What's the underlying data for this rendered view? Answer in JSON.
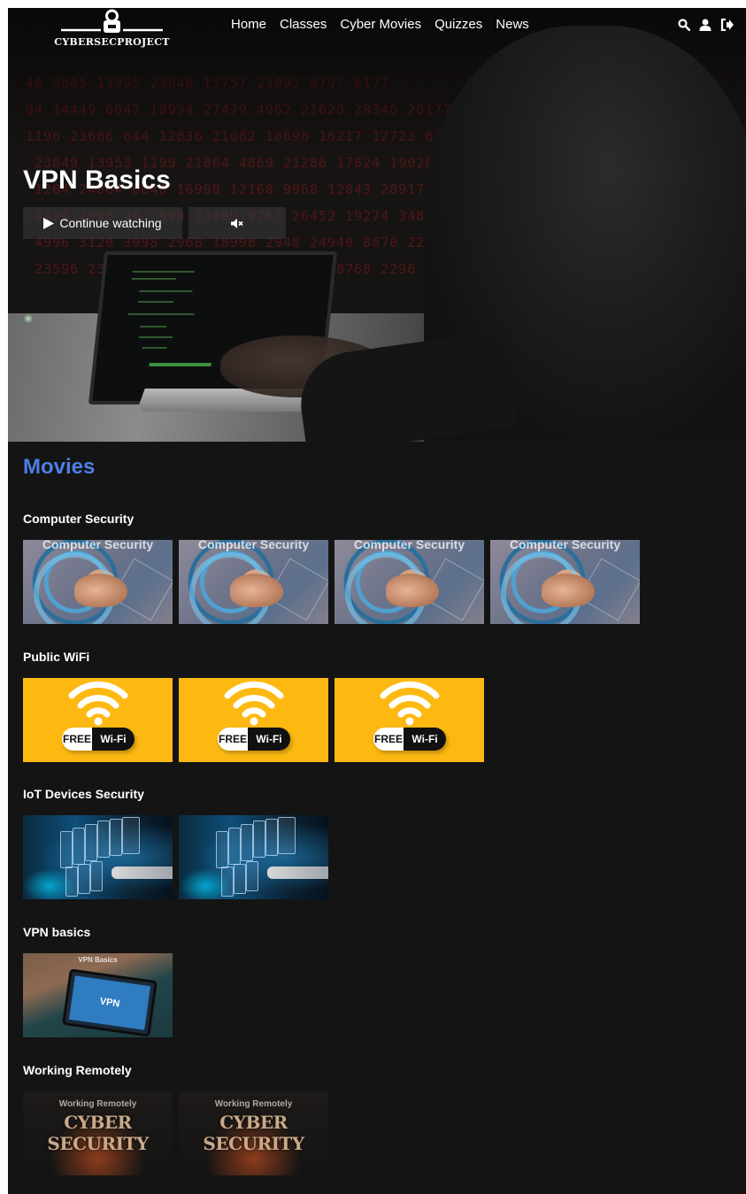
{
  "brand": {
    "name": "CYBERSECPROJECT"
  },
  "nav": {
    "links": [
      "Home",
      "Classes",
      "Cyber Movies",
      "Quizzes",
      "News"
    ],
    "icons": [
      "search-icon",
      "user-icon",
      "logout-icon"
    ]
  },
  "hero": {
    "title": "VPN Basics",
    "continue_label": "Continue watching",
    "mute_icon": "volume-mute-icon"
  },
  "movies": {
    "heading": "Movies",
    "categories": [
      {
        "title": "Computer Security",
        "count": 4,
        "thumb_caption": "Computer Security"
      },
      {
        "title": "Public WiFi",
        "count": 3,
        "thumb_badge_left": "FREE",
        "thumb_badge_right": "Wi-Fi"
      },
      {
        "title": "IoT Devices Security",
        "count": 2
      },
      {
        "title": "VPN basics",
        "count": 1,
        "thumb_caption": "VPN Basics",
        "thumb_screen": "VPN"
      },
      {
        "title": "Working Remotely",
        "count": 2,
        "thumb_caption": "Working Remotely",
        "thumb_big": "CYBER SECURITY"
      }
    ]
  },
  "colors": {
    "accent": "#4d7fe6",
    "background": "#141414",
    "wifi_yellow": "#fdb912"
  }
}
